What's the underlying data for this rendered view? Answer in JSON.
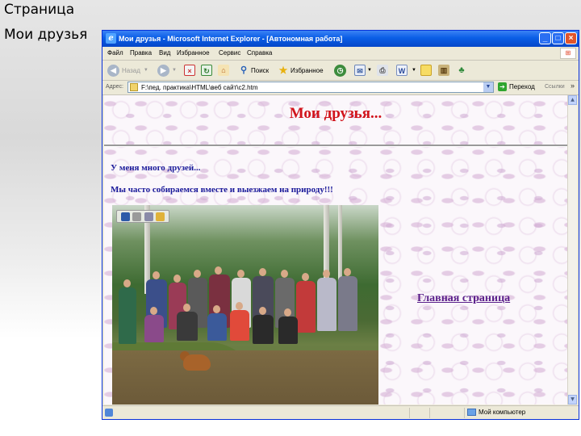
{
  "slide": {
    "title_line1": "Страница",
    "title_line2": "Мои друзья"
  },
  "window": {
    "title": "Мои друзья - Microsoft Internet Explorer - [Автономная работа]",
    "minimize_glyph": "_",
    "maximize_glyph": "□",
    "close_glyph": "×"
  },
  "menu": {
    "items": [
      "Файл",
      "Правка",
      "Вид",
      "Избранное",
      "Сервис",
      "Справка"
    ]
  },
  "toolbar": {
    "back_label": "Назад",
    "search_label": "Поиск",
    "favorites_label": "Избранное"
  },
  "address": {
    "label": "Адрес:",
    "value": "F:\\пед. практика\\HTML\\веб сайт\\c2.htm",
    "go_label": "Переход",
    "links_label": "Ссылки"
  },
  "page": {
    "heading": "Мои друзья...",
    "paragraph1": "У меня много друзей...",
    "paragraph2": "Мы часто собираемся вместе и выезжаем на природу!!!",
    "home_link": "Главная страница"
  },
  "status": {
    "zone": "Мой компьютер"
  },
  "colors": {
    "titlebar": "#0a5ee6",
    "heading": "#d1131b",
    "paragraph": "#1a1a9a",
    "link": "#5a1f8a"
  }
}
